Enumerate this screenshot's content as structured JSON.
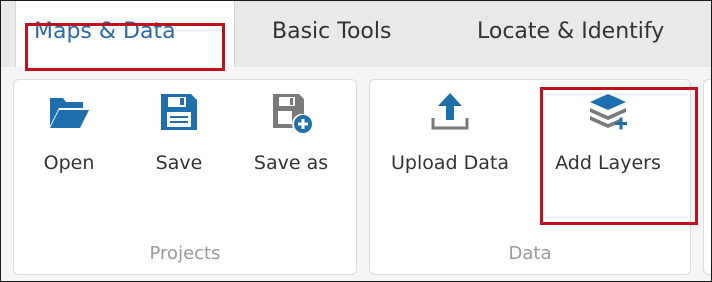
{
  "tabs": [
    {
      "label": "Maps & Data"
    },
    {
      "label": "Basic Tools"
    },
    {
      "label": "Locate & Identify"
    }
  ],
  "groups": {
    "projects": {
      "title": "Projects",
      "buttons": [
        {
          "label": "Open",
          "icon": "folder-open-icon"
        },
        {
          "label": "Save",
          "icon": "floppy-disk-icon"
        },
        {
          "label": "Save as",
          "icon": "floppy-disk-plus-icon"
        }
      ]
    },
    "data": {
      "title": "Data",
      "buttons": [
        {
          "label": "Upload Data",
          "icon": "upload-icon"
        },
        {
          "label": "Add Layers",
          "icon": "layers-plus-icon"
        }
      ]
    }
  },
  "colors": {
    "accent": "#2c6aa6",
    "icon_blue": "#1f6fad",
    "icon_gray": "#7a7a7a",
    "highlight": "#c0121e"
  }
}
